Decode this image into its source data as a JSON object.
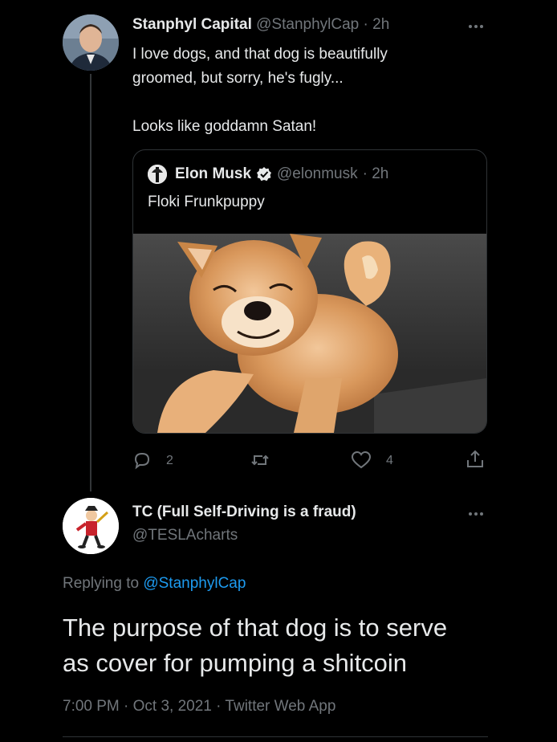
{
  "reply_tweet": {
    "author_name": "Stanphyl Capital",
    "handle": "@StanphylCap",
    "time": "· 2h",
    "text_line1": "I love dogs, and that dog is beautifully",
    "text_line2": "groomed, but sorry, he's fugly...",
    "text_line3": "Looks like goddamn Satan!",
    "quoted": {
      "author_name": "Elon Musk",
      "handle": "@elonmusk",
      "time": "· 2h",
      "text": "Floki Frunkpuppy"
    },
    "actions": {
      "reply_count": "2",
      "retweet_count": "",
      "like_count": "4"
    }
  },
  "main_tweet": {
    "author_name": "TC (Full Self-Driving is a fraud)",
    "handle": "@TESLAcharts",
    "replying_prefix": "Replying to",
    "replying_to": "@StanphylCap",
    "text_line1": "The purpose of that dog is to serve",
    "text_line2": "as cover for pumping a shitcoin",
    "timestamp": "7:00 PM · Oct 3, 2021 · Twitter Web App"
  },
  "colors": {
    "background": "#000000",
    "text": "#e7e9ea",
    "muted": "#71767b",
    "link": "#1d9bf0",
    "verified": "#e7e9ea"
  },
  "icons": [
    "more-icon",
    "verified-icon",
    "reply-icon",
    "retweet-icon",
    "like-icon",
    "share-icon"
  ]
}
